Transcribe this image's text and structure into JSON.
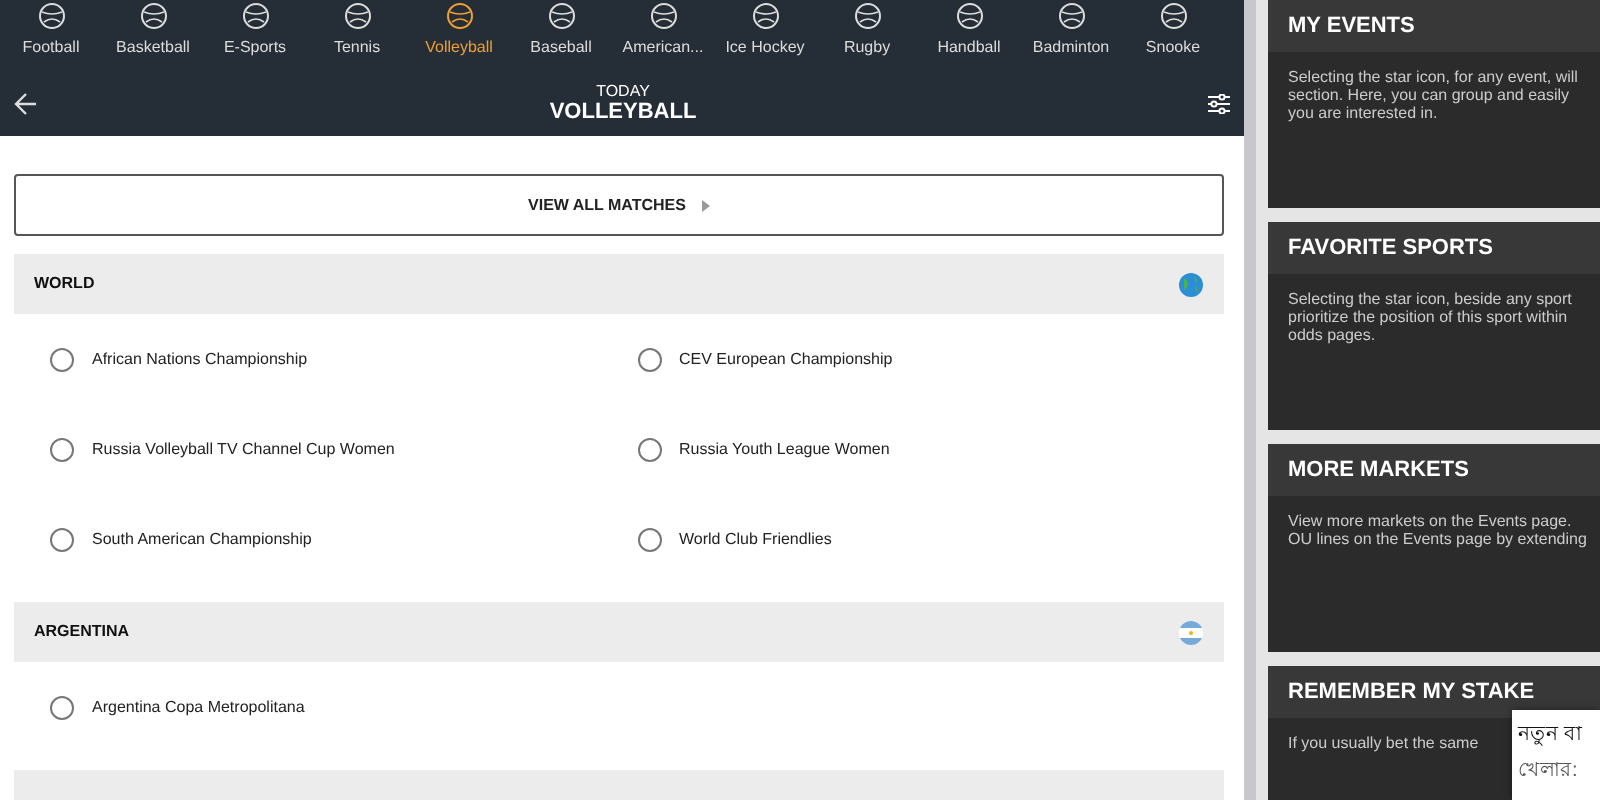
{
  "sports": [
    {
      "label": "Football",
      "selected": false
    },
    {
      "label": "Basketball",
      "selected": false
    },
    {
      "label": "E-Sports",
      "selected": false
    },
    {
      "label": "Tennis",
      "selected": false
    },
    {
      "label": "Volleyball",
      "selected": true
    },
    {
      "label": "Baseball",
      "selected": false
    },
    {
      "label": "American...",
      "selected": false
    },
    {
      "label": "Ice Hockey",
      "selected": false
    },
    {
      "label": "Rugby",
      "selected": false
    },
    {
      "label": "Handball",
      "selected": false
    },
    {
      "label": "Badminton",
      "selected": false
    },
    {
      "label": "Snooke",
      "selected": false
    }
  ],
  "header": {
    "subtitle": "TODAY",
    "title": "VOLLEYBALL"
  },
  "view_all": "VIEW ALL MATCHES",
  "sections": [
    {
      "name": "WORLD",
      "kind": "globe",
      "leagues": [
        {
          "name": "African Nations Championship",
          "selected": false
        },
        {
          "name": "CEV European Championship",
          "selected": false
        },
        {
          "name": "Russia Volleyball TV Channel Cup Women",
          "selected": false
        },
        {
          "name": "Russia Youth League Women",
          "selected": false
        },
        {
          "name": "South American Championship",
          "selected": false
        },
        {
          "name": "World Club Friendlies",
          "selected": false
        }
      ]
    },
    {
      "name": "ARGENTINA",
      "kind": "flag",
      "leagues": [
        {
          "name": "Argentina Copa Metropolitana",
          "selected": false
        }
      ]
    }
  ],
  "info_cards": [
    {
      "title": "MY EVENTS",
      "lines": [
        "Selecting the star icon, for any event, will",
        "section. Here, you can group and easily",
        "you are interested in."
      ]
    },
    {
      "title": "FAVORITE SPORTS",
      "lines": [
        "Selecting the star icon, beside any sport",
        "prioritize the position of this sport within",
        "odds pages."
      ]
    },
    {
      "title": "MORE MARKETS",
      "lines": [
        "View more markets on the Events page.",
        "OU lines on the Events page by extending"
      ]
    },
    {
      "title": "REMEMBER MY STAKE",
      "lines": [
        "If you usually bet the same"
      ]
    }
  ],
  "popup": {
    "title": "নতুন বা",
    "subtitle": "খেলার:"
  }
}
